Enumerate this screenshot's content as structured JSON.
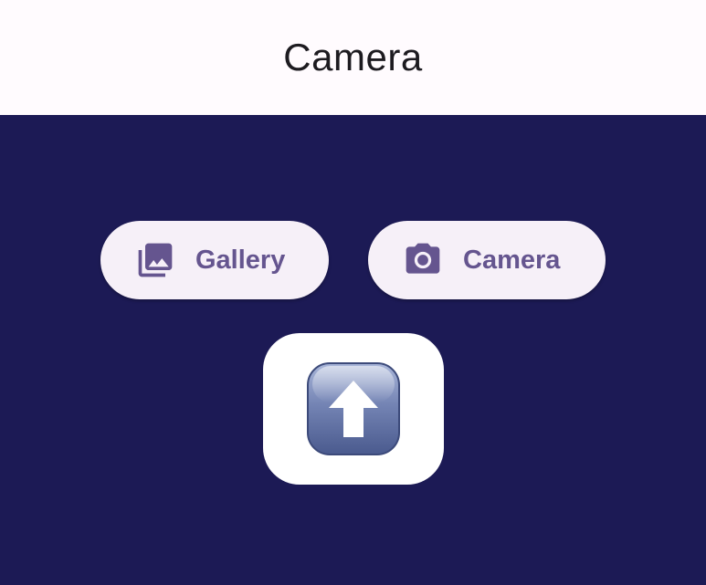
{
  "app_bar": {
    "title": "Camera"
  },
  "actions": {
    "gallery": {
      "label": "Gallery",
      "icon": "photo-library-icon"
    },
    "camera": {
      "label": "Camera",
      "icon": "camera-icon"
    }
  },
  "preview": {
    "icon": "upload-arrow-icon"
  },
  "colors": {
    "background": "#1c1a55",
    "app_bar": "#fffbfe",
    "button_bg": "#f6f0f8",
    "accent": "#65558f",
    "preview_card": "#ffffff"
  }
}
